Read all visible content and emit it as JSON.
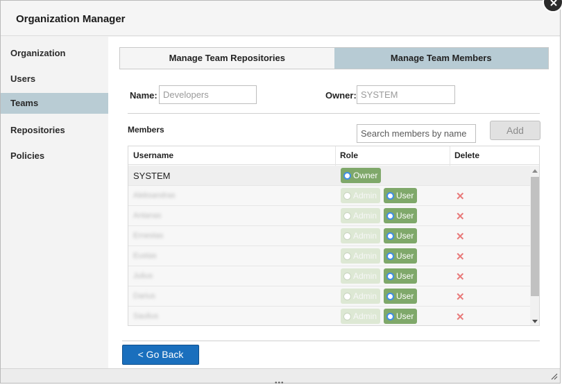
{
  "window": {
    "title": "Organization Manager"
  },
  "sidebar": {
    "items": [
      {
        "label": "Organization",
        "active": false
      },
      {
        "label": "Users",
        "active": false
      },
      {
        "label": "Teams",
        "active": true
      },
      {
        "label": "Repositories",
        "active": false
      },
      {
        "label": "Policies",
        "active": false
      }
    ]
  },
  "tabs": [
    {
      "label": "Manage Team Repositories",
      "active": false
    },
    {
      "label": "Manage Team Members",
      "active": true
    }
  ],
  "form": {
    "name_label": "Name:",
    "name_value": "Developers",
    "owner_label": "Owner:",
    "owner_value": "SYSTEM"
  },
  "members": {
    "label": "Members",
    "search_placeholder": "Search members by name",
    "add_label": "Add",
    "columns": [
      "Username",
      "Role",
      "Delete"
    ],
    "rows": [
      {
        "username": "SYSTEM",
        "role": "Owner",
        "blurred": false,
        "deletable": false
      },
      {
        "username": "Aleksandras",
        "role": "User",
        "blurred": true,
        "deletable": true
      },
      {
        "username": "Antanas",
        "role": "User",
        "blurred": true,
        "deletable": true
      },
      {
        "username": "Ernestas",
        "role": "User",
        "blurred": true,
        "deletable": true
      },
      {
        "username": "Eustas",
        "role": "User",
        "blurred": true,
        "deletable": true
      },
      {
        "username": "Julius",
        "role": "User",
        "blurred": true,
        "deletable": true
      },
      {
        "username": "Darius",
        "role": "User",
        "blurred": true,
        "deletable": true
      },
      {
        "username": "Saulius",
        "role": "User",
        "blurred": true,
        "deletable": true
      }
    ],
    "role_labels": {
      "admin": "Admin",
      "user": "User",
      "owner": "Owner"
    },
    "delete_glyph": "✕"
  },
  "actions": {
    "go_back_label": "< Go Back"
  },
  "colors": {
    "active_tab": "#b7cbd4",
    "sidebar_active": "#b9ccd4",
    "role_on": "#7fa86a",
    "role_off": "#dde8d4",
    "primary_button": "#1a6fbd",
    "delete_x": "#e87a7a"
  }
}
